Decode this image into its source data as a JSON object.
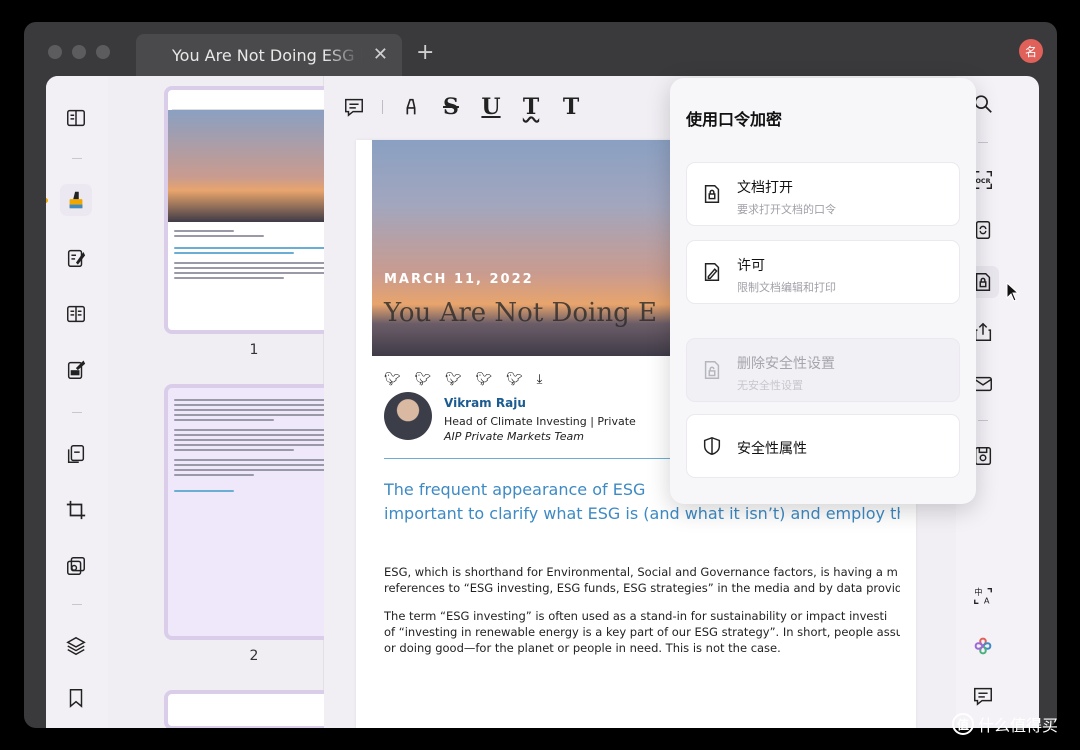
{
  "window": {
    "tab_title": "You Are Not Doing ESG Inv",
    "tab_close": "✕",
    "tab_add": "+",
    "avatar_text": "名"
  },
  "thumbnails": [
    {
      "page_number": "1"
    },
    {
      "page_number": "2"
    }
  ],
  "toolbar": {
    "tools": [
      "comment-tool",
      "highlight-tool",
      "strikethrough-tool",
      "underline-tool",
      "squiggly-tool",
      "text-tool"
    ],
    "strike_label": "S",
    "underline_label": "U",
    "squiggly_label": "T",
    "text_label": "T"
  },
  "document": {
    "hero_date": "MARCH 11, 2022",
    "hero_title": "You Are Not Doing E",
    "author_name": "Vikram Raju",
    "author_role": "Head of Climate Investing | Private",
    "author_team": "AIP Private Markets Team",
    "lead_line1": "The frequent appearance of ESG",
    "lead_line2": "important to clarify what ESG is (and what it isn’t) and employ this",
    "para1_line1": "ESG, which is shorthand for Environmental, Social and Governance factors, is having a m",
    "para1_line2": "references to “ESG investing, ESG funds, ESG strategies” in the media and by data provid",
    "para2_line1": "The term “ESG investing” is often used as a stand-in for sustainability or impact investi",
    "para2_line2": "of “investing in renewable energy is a key part of our ESG strategy”. In short, people assu",
    "para2_line3": "or doing good—for the planet or people in need. This is not the case."
  },
  "popover": {
    "title": "使用口令加密",
    "options": [
      {
        "label": "文档打开",
        "sub": "要求打开文档的口令",
        "enabled": true
      },
      {
        "label": "许可",
        "sub": "限制文档编辑和打印",
        "enabled": true
      },
      {
        "label": "删除安全性设置",
        "sub": "无安全性设置",
        "enabled": false
      },
      {
        "label": "安全性属性",
        "sub": "",
        "enabled": true
      }
    ]
  },
  "watermark": {
    "badge": "值",
    "text": "什么值得买"
  },
  "colors": {
    "accent_blue": "#3d8ac4",
    "author_blue": "#1b5b8f",
    "thumb_border": "#d9cdea",
    "highlight_active": "#f0a800",
    "avatar_red": "#e0605a"
  }
}
